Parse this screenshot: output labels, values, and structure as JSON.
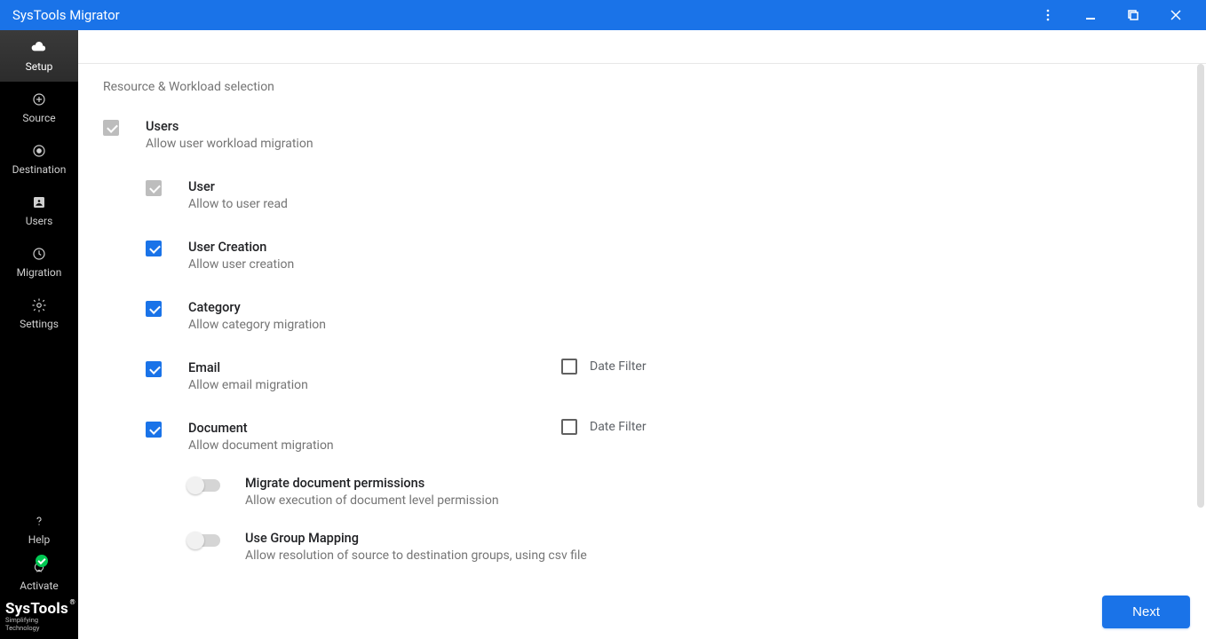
{
  "app": {
    "title": "SysTools Migrator"
  },
  "brand": {
    "name": "SysTools",
    "tagline": "Simplifying Technology",
    "reg": "®"
  },
  "sidebar": {
    "items": [
      {
        "label": "Setup"
      },
      {
        "label": "Source"
      },
      {
        "label": "Destination"
      },
      {
        "label": "Users"
      },
      {
        "label": "Migration"
      },
      {
        "label": "Settings"
      }
    ],
    "footer": [
      {
        "label": "Help"
      },
      {
        "label": "Activate"
      }
    ]
  },
  "page": {
    "section_title": "Resource & Workload selection",
    "next_label": "Next"
  },
  "workloads": {
    "users": {
      "title": "Users",
      "sub": "Allow user workload migration"
    },
    "user": {
      "title": "User",
      "sub": "Allow to user read"
    },
    "user_creation": {
      "title": "User Creation",
      "sub": "Allow user creation"
    },
    "category": {
      "title": "Category",
      "sub": "Allow category migration"
    },
    "email": {
      "title": "Email",
      "sub": "Allow email migration",
      "date_filter_label": "Date Filter"
    },
    "document": {
      "title": "Document",
      "sub": "Allow document migration",
      "date_filter_label": "Date Filter"
    },
    "doc_perms": {
      "title": "Migrate document permissions",
      "sub": "Allow execution of document level permission"
    },
    "group_mapping": {
      "title": "Use Group Mapping",
      "sub": "Allow resolution of source to destination groups, using csv file"
    }
  }
}
